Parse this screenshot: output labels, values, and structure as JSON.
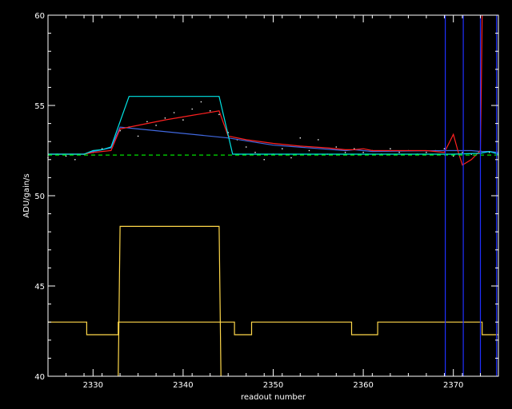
{
  "chart_data": {
    "type": "line",
    "title": "",
    "xlabel": "readout number",
    "ylabel": "ADU/gain/s",
    "xlim": [
      2325,
      2375
    ],
    "ylim": [
      40,
      60
    ],
    "xticks": [
      2330,
      2340,
      2350,
      2360,
      2370
    ],
    "yticks": [
      40,
      45,
      50,
      55,
      60
    ],
    "background": "#000000",
    "axis_color": "#ffffff",
    "grid": false,
    "legend": "none",
    "series": [
      {
        "style": "dotted",
        "color": "#ffffff",
        "x": [
          2325,
          2326,
          2327,
          2328,
          2329,
          2330,
          2331,
          2332,
          2333,
          2334,
          2335,
          2336,
          2337,
          2338,
          2339,
          2340,
          2341,
          2342,
          2343,
          2344,
          2345,
          2346,
          2347,
          2348,
          2349,
          2350,
          2351,
          2352,
          2353,
          2354,
          2355,
          2356,
          2357,
          2358,
          2359,
          2360,
          2361,
          2362,
          2363,
          2364,
          2365,
          2366,
          2367,
          2368,
          2369,
          2370,
          2371,
          2372,
          2373,
          2374
        ],
        "y": [
          52.1,
          52.3,
          52.2,
          52.0,
          52.3,
          52.4,
          52.6,
          52.7,
          53.6,
          53.8,
          53.3,
          54.1,
          53.9,
          54.3,
          54.6,
          54.2,
          54.8,
          55.2,
          54.7,
          54.5,
          53.5,
          53.1,
          52.7,
          52.4,
          52.0,
          52.3,
          52.6,
          52.1,
          53.2,
          52.5,
          53.1,
          52.3,
          52.7,
          52.4,
          52.6,
          52.4,
          52.5,
          52.3,
          52.6,
          52.4,
          52.5,
          52.3,
          52.4,
          52.5,
          52.6,
          52.2,
          52.4,
          52.3,
          52.5,
          52.4
        ]
      },
      {
        "style": "solid",
        "color": "#4169e1",
        "x": [
          2325,
          2329,
          2330,
          2331,
          2332,
          2333,
          2345,
          2350,
          2358,
          2359,
          2360,
          2361,
          2369,
          2371,
          2372,
          2373,
          2374,
          2375
        ],
        "y": [
          52.3,
          52.3,
          52.45,
          52.55,
          52.65,
          53.8,
          53.2,
          52.8,
          52.5,
          52.55,
          52.5,
          52.45,
          52.5,
          52.5,
          52.5,
          52.45,
          52.45,
          52.4
        ]
      },
      {
        "style": "solid",
        "color": "#ff2020",
        "x": [
          2325,
          2329,
          2330,
          2331,
          2332,
          2333,
          2335,
          2338,
          2341,
          2344,
          2345,
          2347,
          2350,
          2353,
          2356,
          2358,
          2359,
          2360,
          2361,
          2364,
          2367,
          2369,
          2369.5,
          2370,
          2370.5,
          2371,
          2372,
          2373,
          2373.1,
          2373.2
        ],
        "y": [
          52.3,
          52.3,
          52.4,
          52.45,
          52.5,
          53.7,
          53.9,
          54.2,
          54.45,
          54.7,
          53.3,
          53.1,
          52.9,
          52.75,
          52.65,
          52.55,
          52.55,
          52.6,
          52.5,
          52.5,
          52.5,
          52.4,
          52.9,
          53.4,
          52.5,
          51.7,
          52.0,
          52.5,
          56.0,
          60.0
        ]
      },
      {
        "style": "solid",
        "color": "#00e5e5",
        "x": [
          2325,
          2329,
          2330,
          2331,
          2332,
          2334,
          2344,
          2345.5,
          2370,
          2373,
          2374,
          2375
        ],
        "y": [
          52.3,
          52.3,
          52.5,
          52.55,
          52.7,
          55.5,
          55.5,
          52.3,
          52.3,
          52.35,
          52.45,
          52.3
        ]
      },
      {
        "style": "dashed",
        "color": "#00e000",
        "x": [
          2325,
          2375
        ],
        "y": [
          52.25,
          52.25
        ]
      },
      {
        "style": "solid",
        "color": "#ffd84a",
        "x": [
          2325,
          2329.3,
          2329.3,
          2332.8,
          2332.8,
          2345.7,
          2345.7,
          2347.6,
          2347.6,
          2358.7,
          2358.7,
          2361.6,
          2361.6,
          2373.2,
          2373.2,
          2375
        ],
        "y": [
          43.0,
          43.0,
          42.3,
          42.3,
          43.0,
          43.0,
          42.3,
          42.3,
          43.0,
          43.0,
          42.3,
          42.3,
          43.0,
          43.0,
          42.3,
          42.3
        ]
      },
      {
        "style": "solid",
        "color": "#ffd84a",
        "x": [
          2332.8,
          2333.0,
          2333.2,
          2343.8,
          2344.0,
          2344.2
        ],
        "y": [
          40.0,
          48.3,
          48.3,
          48.3,
          48.3,
          40.0
        ]
      }
    ],
    "vlines": [
      {
        "x": 2369.1,
        "color": "#2030ff"
      },
      {
        "x": 2371.1,
        "color": "#2030ff"
      },
      {
        "x": 2373.0,
        "color": "#2030ff"
      },
      {
        "x": 2374.8,
        "color": "#2030ff"
      }
    ]
  }
}
